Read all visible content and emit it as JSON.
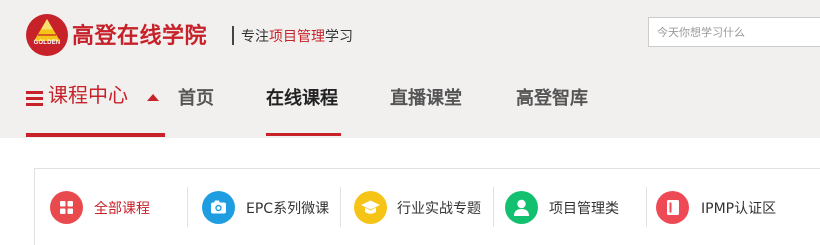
{
  "brand": {
    "logo_text": "GOLDEN",
    "site_name": "高登在线学院",
    "tagline_prefix": "专注",
    "tagline_highlight": "项目管理",
    "tagline_suffix": "学习"
  },
  "search": {
    "placeholder": "今天你想学习什么"
  },
  "nav": {
    "course_center": "课程中心",
    "items": [
      {
        "label": "首页"
      },
      {
        "label": "在线课程"
      },
      {
        "label": "直播课堂"
      },
      {
        "label": "高登智库"
      }
    ],
    "active_item": "在线课程"
  },
  "categories": [
    {
      "label": "全部课程",
      "icon": "grid-icon",
      "color": "#e84a4e",
      "active": true
    },
    {
      "label": "EPC系列微课",
      "icon": "camera-icon",
      "color": "#1e9ee0",
      "active": false
    },
    {
      "label": "行业实战专题",
      "icon": "graduation-cap-icon",
      "color": "#f5c417",
      "active": false
    },
    {
      "label": "项目管理类",
      "icon": "user-icon",
      "color": "#13c06f",
      "active": false
    },
    {
      "label": "IPMP认证区",
      "icon": "certificate-icon",
      "color": "#ee4a56",
      "active": false
    }
  ],
  "colors": {
    "brand_red": "#c7222a",
    "header_bg": "#f2f0ef"
  }
}
